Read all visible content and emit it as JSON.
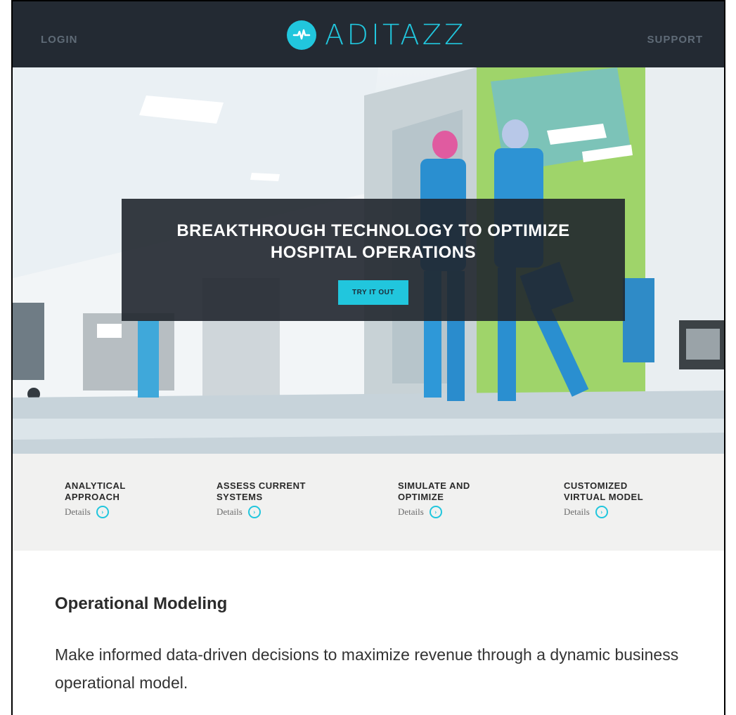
{
  "header": {
    "login_label": "LOGIN",
    "logo_text": "ADITAZZ",
    "support_label": "SUPPORT",
    "brand_color": "#21c6dd",
    "background_color": "#232a33"
  },
  "hero": {
    "title": "BREAKTHROUGH TECHNOLOGY TO OPTIMIZE HOSPITAL OPERATIONS",
    "button_label": "TRY IT OUT",
    "background_description_color": "#dfe7ec"
  },
  "features": [
    {
      "title": "ANALYTICAL\nAPPROACH",
      "details_label": "Details",
      "icon": "chevron-right-circle-icon"
    },
    {
      "title": "ASSESS CURRENT\nSYSTEMS",
      "details_label": "Details",
      "icon": "chevron-right-circle-icon"
    },
    {
      "title": "SIMULATE AND\nOPTIMIZE",
      "details_label": "Details",
      "icon": "chevron-right-circle-icon"
    },
    {
      "title": "CUSTOMIZED\nVIRTUAL MODEL",
      "details_label": "Details",
      "icon": "chevron-right-circle-icon"
    }
  ],
  "content": {
    "title": "Operational Modeling",
    "text": "Make informed data-driven decisions to maximize revenue through a dynamic business operational model."
  }
}
